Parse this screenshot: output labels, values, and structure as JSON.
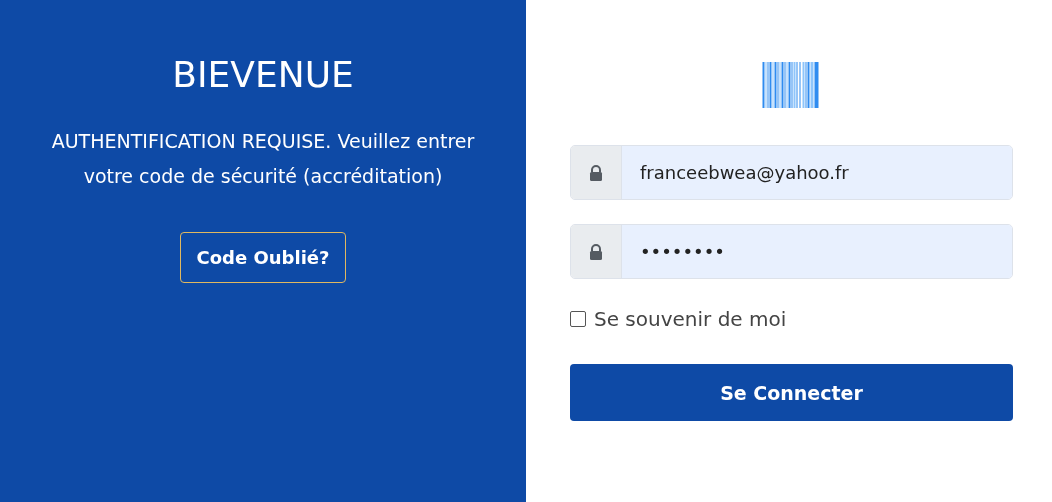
{
  "welcome": {
    "title": "BIEVENUE",
    "message": "AUTHENTIFICATION REQUISE. Veuillez entrer votre code de sécurité (accréditation)",
    "forgot_button": "Code Oublié?"
  },
  "login": {
    "email": {
      "value": "franceebwea@yahoo.fr"
    },
    "password": {
      "value": "••••••••"
    },
    "remember": {
      "label": "Se souvenir de moi",
      "checked": false
    },
    "submit": "Se Connecter"
  }
}
